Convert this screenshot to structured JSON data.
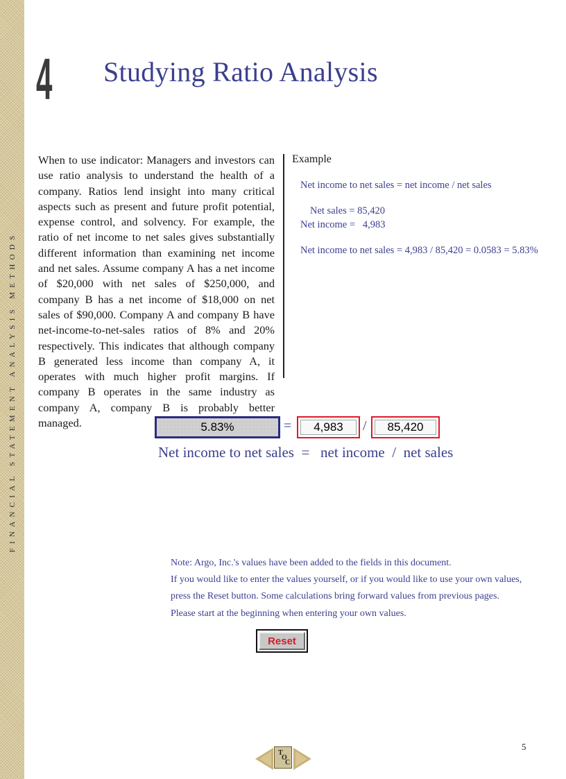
{
  "sidebar": {
    "text": "FINANCIAL STATEMENT ANALYSIS METHODS"
  },
  "chapter": {
    "number": "4",
    "title": "Studying Ratio Analysis"
  },
  "body": {
    "paragraph": "When to use indicator: Managers and investors can use ratio analysis to understand the health of a company. Ratios lend insight into many critical aspects such as present and future profit potential, expense control, and solvency. For example, the ratio of net income to net sales gives substantially different information than examining net income and net sales. Assume company A has a net income of $20,000 with net sales of $250,000, and company B has a net income of $18,000 on net sales of $90,000. Company A and company B have net-income-to-net-sales ratios of 8% and 20% respectively. This indicates that although company B generated less income than company A, it operates with much higher profit margins. If company B operates in the same industry as company A, company B is probably better managed."
  },
  "example": {
    "heading": "Example",
    "formula_line": "Net income to net sales = net income / net sales",
    "net_sales_line": "Net sales = 85,420",
    "net_income_line": "Net income =   4,983",
    "result_line": "Net income to net sales = 4,983 / 85,420 = 0.0583 = 5.83%"
  },
  "calculator": {
    "result": "5.83%",
    "equals": "=",
    "net_income": "4,983",
    "divide": "/",
    "net_sales": "85,420",
    "formula_label": "Net income to net sales  =   net income  /  net sales"
  },
  "note": {
    "lines": [
      "Note: Argo, Inc.'s values have been added to the fields in this document.",
      "If you would like to enter the values yourself, or if you would like to use your own values,",
      "press the Reset button. Some calculations bring forward values from previous pages.",
      "Please start at the beginning when entering your own values."
    ]
  },
  "reset_button": {
    "label": "Reset"
  },
  "footer": {
    "page_number": "5",
    "toc_letters": {
      "t": "T",
      "o": "O",
      "c": "C"
    }
  },
  "colors": {
    "accent": "#3b3f8f",
    "field_border": "#e0182a",
    "reset_text": "#d61a2a",
    "sidebar": "#d6c79a"
  }
}
